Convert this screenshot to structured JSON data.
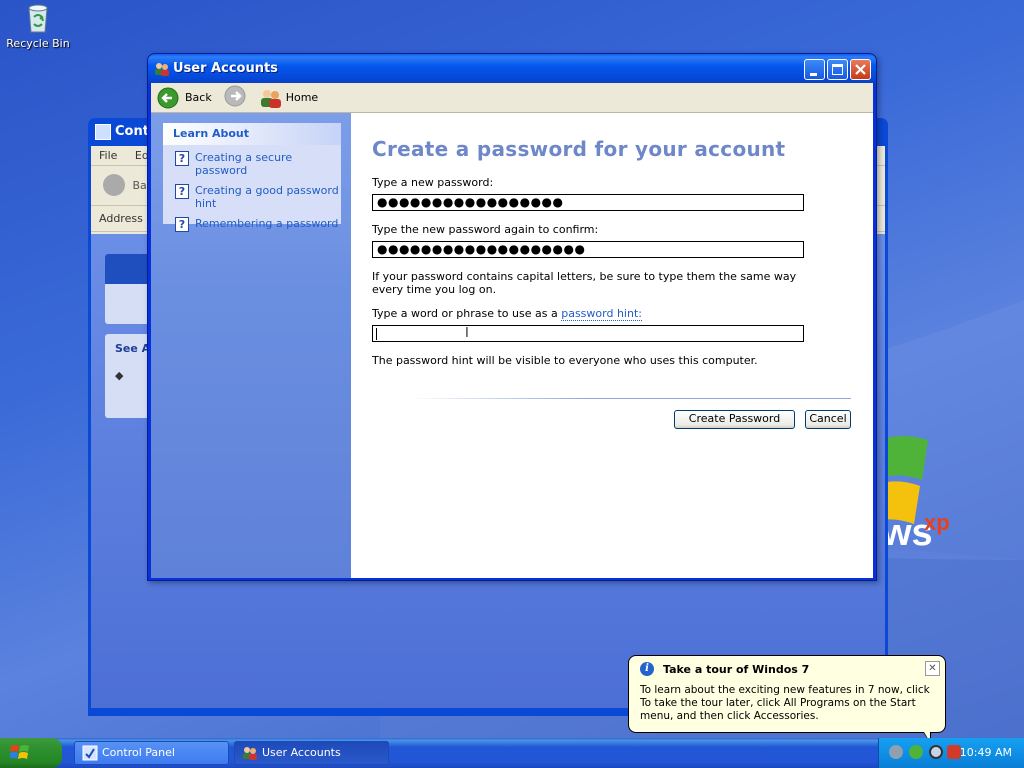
{
  "desktop": {
    "recycle_bin_label": "Recycle Bin"
  },
  "background_window": {
    "title": "Contr",
    "menu": [
      "File",
      "Ed"
    ],
    "back_label": "Bac",
    "address_label": "Address",
    "panel_label": "See A"
  },
  "window": {
    "title": "User Accounts"
  },
  "nav": {
    "back_label": "Back",
    "home_label": "Home"
  },
  "learn_about": {
    "heading": "Learn About",
    "items": [
      "Creating a secure password",
      "Creating a good password hint",
      "Remembering a password"
    ]
  },
  "form": {
    "heading": "Create a password for your account",
    "new_password_label": "Type a new password:",
    "new_password_value": "●●●●●●●●●●●●●●●●●",
    "confirm_label": "Type the new password again to confirm:",
    "confirm_value": "●●●●●●●●●●●●●●●●●●●",
    "caps_note": "If your password contains capital letters, be sure to type them the same way every time you log on.",
    "hint_label_prefix": "Type a word or phrase to use as a",
    "hint_link": "password hint:",
    "hint_value": "",
    "hint_note": "The password hint will be visible to everyone who uses this computer.",
    "create_button": "Create Password",
    "cancel_button": "Cancel"
  },
  "balloon": {
    "title": "Take a tour of Windos 7",
    "body": "To learn about the exciting new features in 7 now, click To take the tour later, click All Programs on the Start menu, and then click Accessories."
  },
  "taskbar": {
    "tasks": [
      "Control Panel",
      "User Accounts"
    ],
    "clock": "10:49 AM"
  },
  "colors": {
    "title_blue": "#0558ed",
    "heading_blue": "#6e87c8",
    "link_blue": "#215dc6",
    "balloon_bg": "#ffffe1"
  }
}
